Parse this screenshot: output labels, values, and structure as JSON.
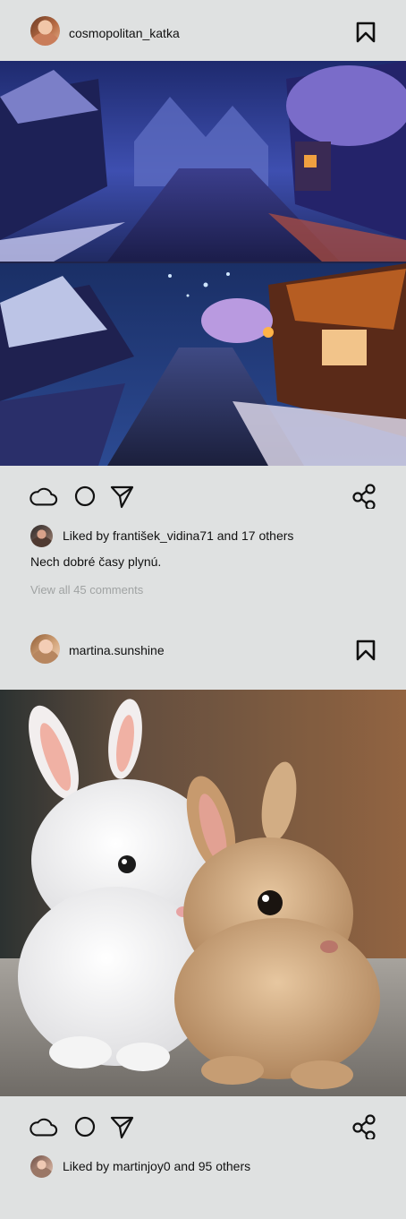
{
  "posts": [
    {
      "username": "cosmopolitan_katka",
      "liked_text": "Liked by františek_vidina71 and 17 others",
      "caption": "Nech dobré časy plynú.",
      "comments_link": "View all 45 comments"
    },
    {
      "username": "martina.sunshine",
      "liked_text": "Liked by martinjoy0 and 95 others"
    }
  ],
  "icons": {
    "bookmark": "bookmark-icon",
    "like": "cloud-icon",
    "comment": "circle-icon",
    "send": "paper-plane-icon",
    "share": "share-icon"
  },
  "colors": {
    "background": "#dfe1e1",
    "muted_text": "#a0a3a3",
    "text": "#111111"
  }
}
